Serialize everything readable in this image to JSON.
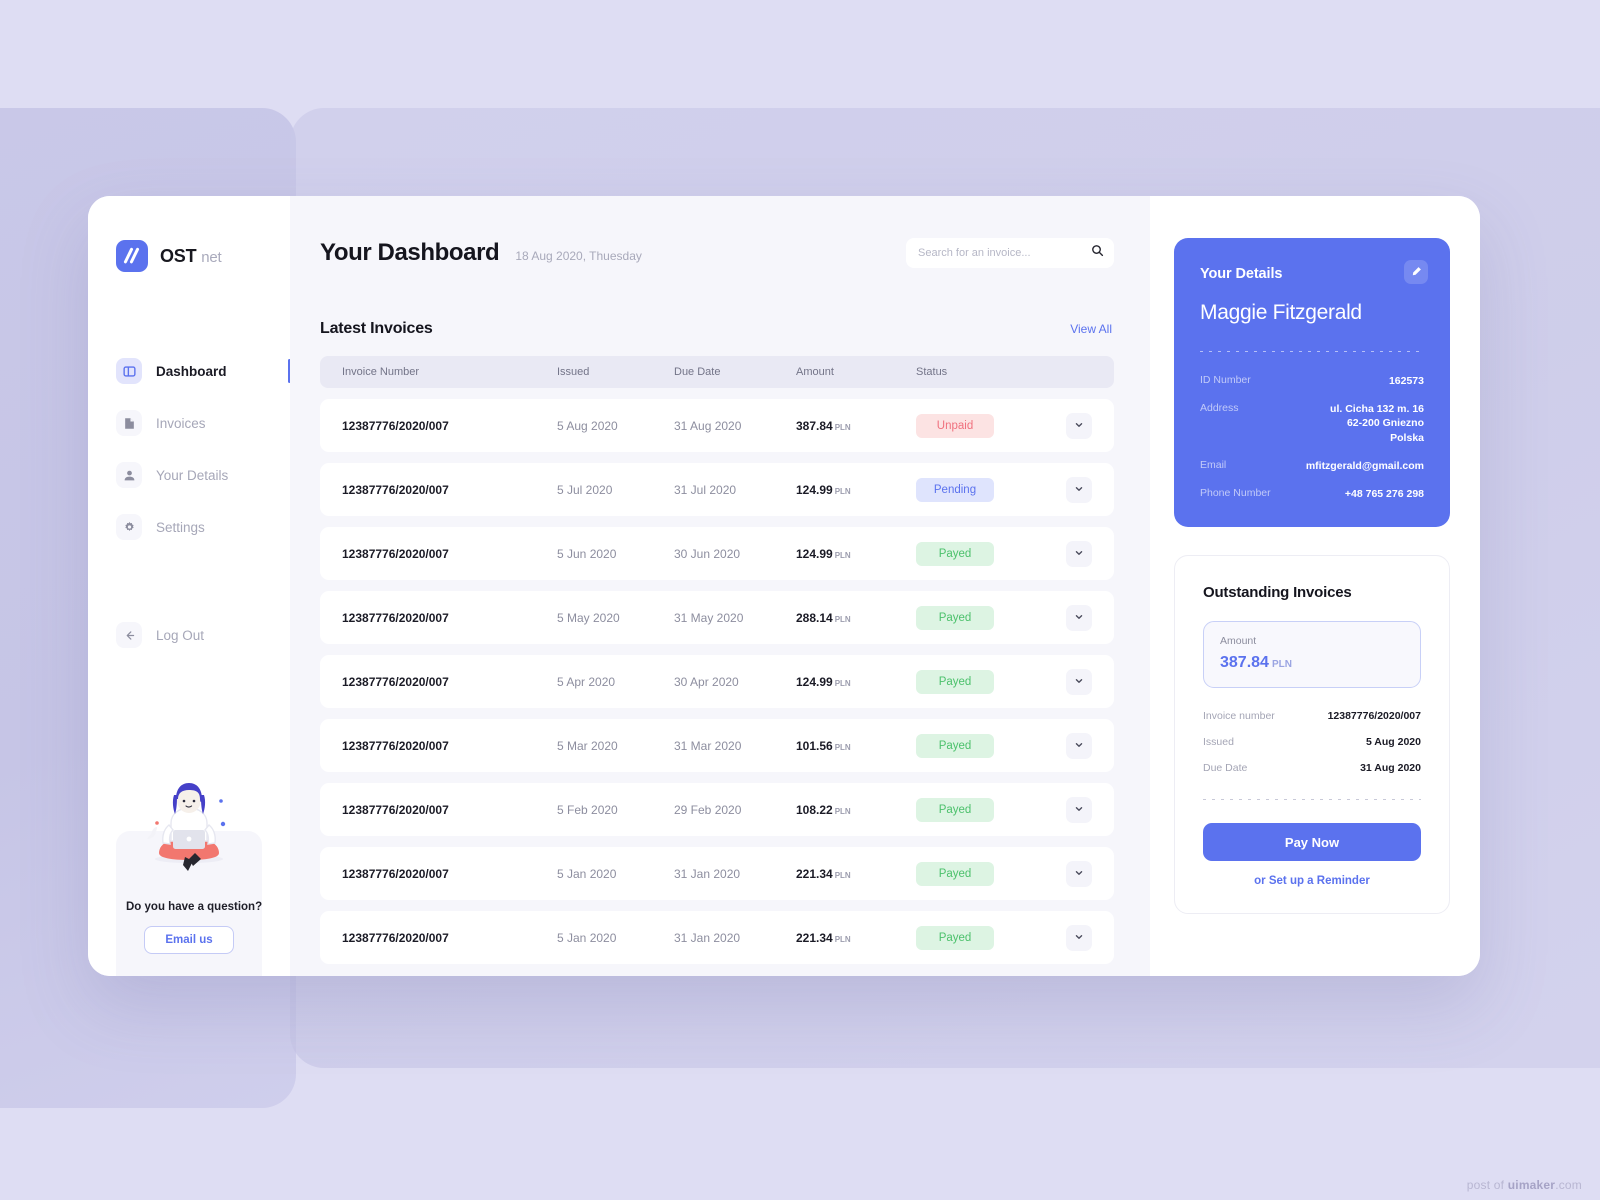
{
  "brand": {
    "name": "OST",
    "suffix": "net"
  },
  "sidebar": {
    "items": [
      {
        "label": "Dashboard",
        "icon": "dashboard-icon"
      },
      {
        "label": "Invoices",
        "icon": "document-icon"
      },
      {
        "label": "Your Details",
        "icon": "user-icon"
      },
      {
        "label": "Settings",
        "icon": "gear-icon"
      }
    ],
    "logout": {
      "label": "Log Out",
      "icon": "arrow-left-icon"
    },
    "help": {
      "title": "Do you have a question?",
      "button": "Email us",
      "illustration": "woman-with-laptop-illustration"
    }
  },
  "header": {
    "title": "Your Dashboard",
    "date": "18 Aug 2020, Thuesday",
    "search": {
      "value": "",
      "placeholder": "Search for an invoice..."
    }
  },
  "invoices": {
    "section_title": "Latest Invoices",
    "view_all": "View All",
    "columns": [
      "Invoice Number",
      "Issued",
      "Due Date",
      "Amount",
      "Status"
    ],
    "currency": "PLN",
    "rows": [
      {
        "number": "12387776/2020/007",
        "issued": "5 Aug 2020",
        "due": "31 Aug 2020",
        "amount": "387.84",
        "currency": "PLN",
        "status": "Unpaid",
        "status_kind": "unpaid"
      },
      {
        "number": "12387776/2020/007",
        "issued": "5 Jul 2020",
        "due": "31 Jul 2020",
        "amount": "124.99",
        "currency": "PLN",
        "status": "Pending",
        "status_kind": "pending"
      },
      {
        "number": "12387776/2020/007",
        "issued": "5 Jun 2020",
        "due": "30 Jun 2020",
        "amount": "124.99",
        "currency": "PLN",
        "status": "Payed",
        "status_kind": "payed"
      },
      {
        "number": "12387776/2020/007",
        "issued": "5 May 2020",
        "due": "31 May 2020",
        "amount": "288.14",
        "currency": "PLN",
        "status": "Payed",
        "status_kind": "payed"
      },
      {
        "number": "12387776/2020/007",
        "issued": "5 Apr 2020",
        "due": "30 Apr 2020",
        "amount": "124.99",
        "currency": "PLN",
        "status": "Payed",
        "status_kind": "payed"
      },
      {
        "number": "12387776/2020/007",
        "issued": "5 Mar 2020",
        "due": "31 Mar 2020",
        "amount": "101.56",
        "currency": "PLN",
        "status": "Payed",
        "status_kind": "payed"
      },
      {
        "number": "12387776/2020/007",
        "issued": "5 Feb 2020",
        "due": "29 Feb 2020",
        "amount": "108.22",
        "currency": "PLN",
        "status": "Payed",
        "status_kind": "payed"
      },
      {
        "number": "12387776/2020/007",
        "issued": "5 Jan 2020",
        "due": "31 Jan 2020",
        "amount": "221.34",
        "currency": "PLN",
        "status": "Payed",
        "status_kind": "payed"
      },
      {
        "number": "12387776/2020/007",
        "issued": "5 Jan 2020",
        "due": "31 Jan 2020",
        "amount": "221.34",
        "currency": "PLN",
        "status": "Payed",
        "status_kind": "payed"
      }
    ]
  },
  "details": {
    "heading": "Your Details",
    "name": "Maggie Fitzgerald",
    "fields": [
      {
        "label": "ID Number",
        "value": "162573"
      },
      {
        "label": "Address",
        "value": "ul. Cicha 132 m. 16\n62-200 Gniezno\nPolska"
      },
      {
        "label": "Email",
        "value": "mfitzgerald@gmail.com"
      },
      {
        "label": "Phone Number",
        "value": "+48 765 276  298"
      }
    ],
    "edit_icon": "pencil-icon"
  },
  "outstanding": {
    "title": "Outstanding Invoices",
    "amount_label": "Amount",
    "amount": "387.84",
    "currency": "PLN",
    "fields": [
      {
        "label": "Invoice number",
        "value": "12387776/2020/007"
      },
      {
        "label": "Issued",
        "value": "5 Aug 2020"
      },
      {
        "label": "Due Date",
        "value": "31 Aug 2020"
      }
    ],
    "pay_button": "Pay Now",
    "reminder_link": "or Set up a Reminder"
  },
  "watermark": {
    "prefix": "post of ",
    "brand": "uimaker",
    "suffix": ".com"
  },
  "colors": {
    "accent": "#5B72EE",
    "page_bg": "#DEDDF3",
    "panel_bg": "#C7C6E7",
    "main_bg": "#F6F6FB",
    "status_unpaid_bg": "#FCE3E3",
    "status_unpaid_fg": "#F0717E",
    "status_pending_bg": "#DFE4FD",
    "status_pending_fg": "#5B72EE",
    "status_payed_bg": "#DDF4E3",
    "status_payed_fg": "#4CC16C"
  }
}
